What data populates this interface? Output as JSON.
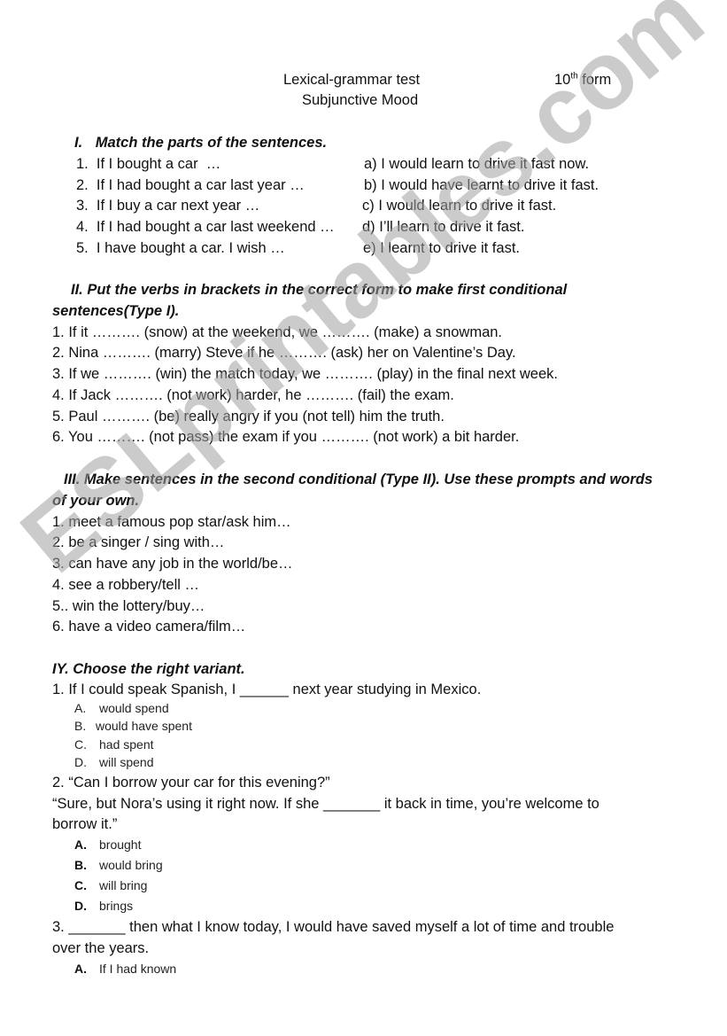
{
  "header": {
    "title": "Lexical-grammar test",
    "subtitle": "Subjunctive Mood",
    "form_number": "10",
    "form_sup": "th",
    "form_label": "form"
  },
  "section1": {
    "heading_num": "I.",
    "heading": "Match the parts of the sentences.",
    "left": [
      "1.  If I bought a car  …",
      "2.  If I had bought a car last year …",
      "3.  If I buy a car next year …",
      "4.  If I had bought a car last weekend …",
      "5.  I have bought a car. I wish …"
    ],
    "right": [
      "a) I would learn to drive it fast now.",
      "b) I would have learnt to drive it fast.",
      "c) I would learn to drive it fast.",
      "d) I’ll learn to drive it fast.",
      "e) I learnt to drive it fast."
    ]
  },
  "section2": {
    "heading_line1": "II. Put the verbs in brackets in the correct form to make first conditional",
    "heading_line2": "sentences(Type I).",
    "items": [
      "1. If it ………. (snow) at the weekend, we ………. (make) a snowman.",
      "2. Nina ………. (marry) Steve if he ………. (ask) her on Valentine’s Day.",
      "3. If we ………. (win) the match today, we ………. (play) in the final next week.",
      "4. If Jack ………. (not work) harder, he ………. (fail) the exam.",
      "5. Paul ………. (be) really angry if you (not tell) him the truth.",
      "6. You ………. (not pass) the exam if you ………. (not work) a bit harder."
    ]
  },
  "section3": {
    "heading_line1": "III. Make sentences in the second conditional (Type II). Use these prompts and words",
    "heading_line2": "of your own.",
    "items": [
      "1. meet a famous pop star/ask him…",
      "2. be a singer / sing with…",
      "3. can have any job in the world/be…",
      "4. see a robbery/tell …",
      "5.. win the lottery/buy…",
      "6. have a video camera/film…"
    ]
  },
  "section4": {
    "heading": "IY. Choose the right variant.",
    "q1": {
      "text": "1. If I could speak Spanish, I ______ next year studying in Mexico.",
      "options": [
        {
          "letter": "A.",
          "text": "would spend"
        },
        {
          "letter": "B.",
          "text": "would have spent"
        },
        {
          "letter": "C.",
          "text": "had spent"
        },
        {
          "letter": "D.",
          "text": "will spend"
        }
      ]
    },
    "q2": {
      "line1": "2. “Can I borrow your car for this evening?”",
      "line2": "“Sure, but Nora’s using it right now. If she _______ it back in time, you’re welcome to",
      "line3": "borrow it.”",
      "options": [
        {
          "letter": "A.",
          "text": "brought"
        },
        {
          "letter": "B.",
          "text": "would bring"
        },
        {
          "letter": "C.",
          "text": "will bring"
        },
        {
          "letter": "D.",
          "text": "brings"
        }
      ]
    },
    "q3": {
      "line1": "3. _______ then what I know today, I would have saved myself a lot of time and trouble",
      "line2": "over the years.",
      "options": [
        {
          "letter": "A.",
          "text": "If I had known"
        }
      ]
    }
  },
  "watermark": "ESLprintables.com"
}
